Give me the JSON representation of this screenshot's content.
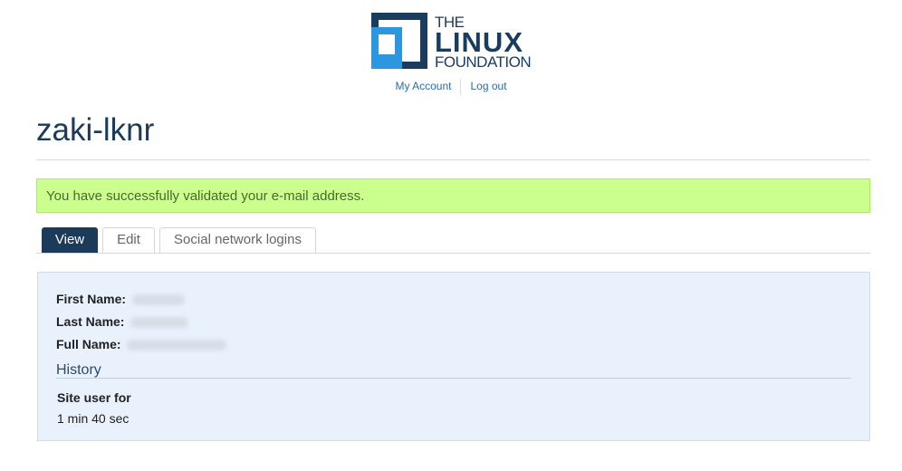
{
  "header": {
    "logo_line1": "THE",
    "logo_line2": "LINUX",
    "logo_line3": "FOUNDATION",
    "links": [
      {
        "label": "My Account"
      },
      {
        "label": "Log out"
      }
    ]
  },
  "page": {
    "title": "zaki-lknr"
  },
  "message": {
    "text": "You have successfully validated your e-mail address."
  },
  "tabs": [
    {
      "label": "View",
      "active": true
    },
    {
      "label": "Edit",
      "active": false
    },
    {
      "label": "Social network logins",
      "active": false
    }
  ],
  "profile": {
    "fields": [
      {
        "label": "First Name:"
      },
      {
        "label": "Last Name:"
      },
      {
        "label": "Full Name:"
      }
    ],
    "history_title": "History",
    "member_label": "Site user for",
    "member_value": "1 min 40 sec"
  },
  "colors": {
    "brand_navy": "#1c3a5a",
    "brand_blue": "#2c97de",
    "success_bg": "#cbff8e",
    "panel_bg": "#e9f1fd"
  }
}
